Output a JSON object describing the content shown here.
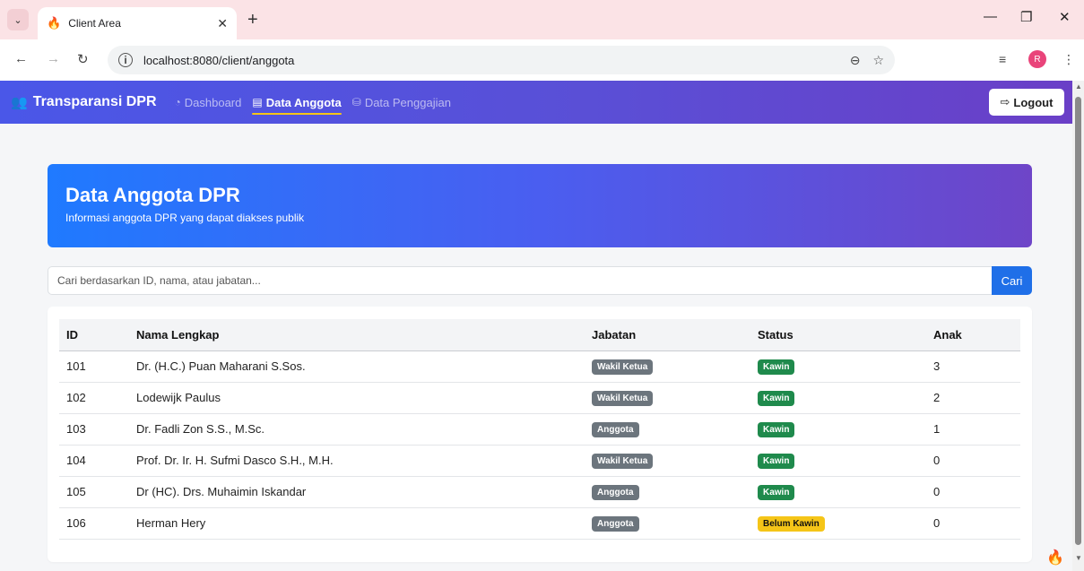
{
  "browser": {
    "tab_title": "Client Area",
    "url": "localhost:8080/client/anggota",
    "profile_initial": "R"
  },
  "navbar": {
    "brand": "Transparansi DPR",
    "links": [
      {
        "label": "Dashboard",
        "active": false
      },
      {
        "label": "Data Anggota",
        "active": true
      },
      {
        "label": "Data Penggajian",
        "active": false
      }
    ],
    "logout_label": "Logout"
  },
  "hero": {
    "title": "Data Anggota DPR",
    "subtitle": "Informasi anggota DPR yang dapat diakses publik"
  },
  "search": {
    "placeholder": "Cari berdasarkan ID, nama, atau jabatan...",
    "button_label": "Cari"
  },
  "table": {
    "headers": [
      "ID",
      "Nama Lengkap",
      "Jabatan",
      "Status",
      "Anak"
    ],
    "rows": [
      {
        "id": "101",
        "nama": "Dr. (H.C.) Puan Maharani S.Sos.",
        "jabatan": "Wakil Ketua",
        "status": "Kawin",
        "anak": "3"
      },
      {
        "id": "102",
        "nama": "Lodewijk Paulus",
        "jabatan": "Wakil Ketua",
        "status": "Kawin",
        "anak": "2"
      },
      {
        "id": "103",
        "nama": "Dr. Fadli Zon S.S., M.Sc.",
        "jabatan": "Anggota",
        "status": "Kawin",
        "anak": "1"
      },
      {
        "id": "104",
        "nama": "Prof. Dr. Ir. H. Sufmi Dasco S.H., M.H.",
        "jabatan": "Wakil Ketua",
        "status": "Kawin",
        "anak": "0"
      },
      {
        "id": "105",
        "nama": "Dr (HC). Drs. Muhaimin Iskandar",
        "jabatan": "Anggota",
        "status": "Kawin",
        "anak": "0"
      },
      {
        "id": "106",
        "nama": "Herman Hery",
        "jabatan": "Anggota",
        "status": "Belum Kawin",
        "anak": "0"
      }
    ]
  },
  "colors": {
    "primary": "#1f6fe8",
    "badge_grey": "#6c757d",
    "badge_green": "#1f8a4c",
    "badge_yellow": "#f5c518",
    "nav_active_underline": "#f5c518"
  }
}
